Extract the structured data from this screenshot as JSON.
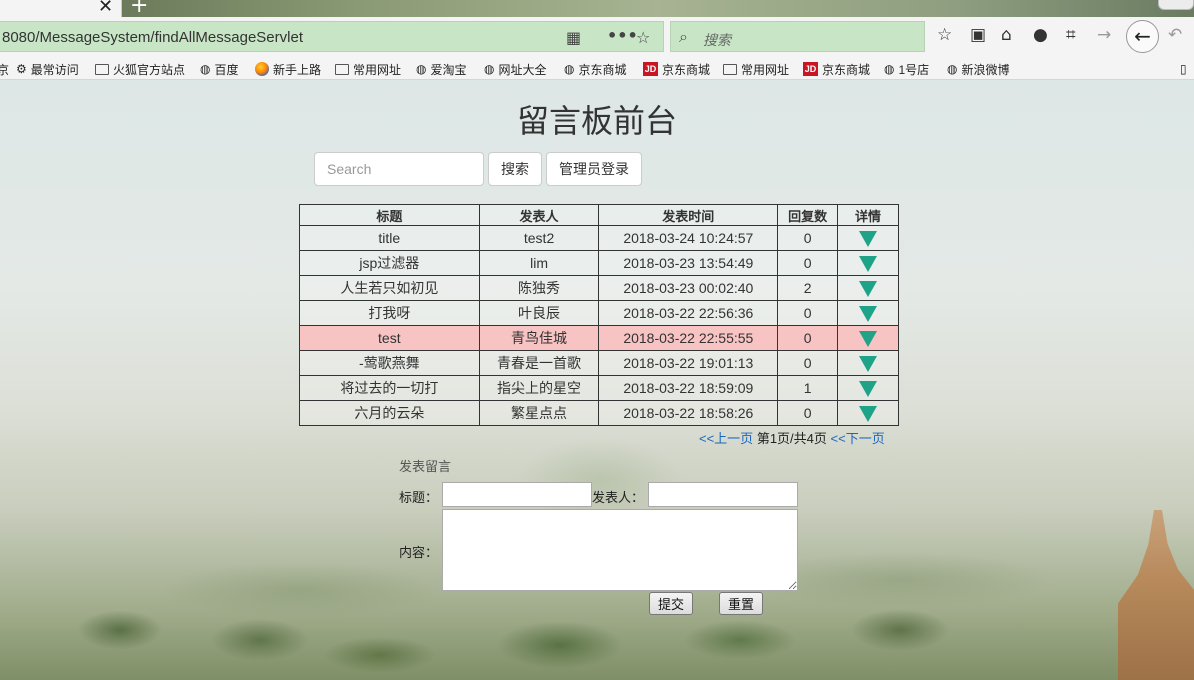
{
  "browser": {
    "url": "8080/MessageSystem/findAllMessageServlet",
    "search_placeholder": "搜索",
    "bookmarks": [
      "最常访问",
      "火狐官方站点",
      "百度",
      "新手上路",
      "常用网址",
      "爱淘宝",
      "网址大全",
      "京东商城",
      "京东商城",
      "常用网址",
      "京东商城",
      "1号店",
      "新浪微博"
    ],
    "bookmark_prefix": "京"
  },
  "page": {
    "title": "留言板前台",
    "search_placeholder": "Search",
    "search_button": "搜索",
    "admin_login_button": "管理员登录"
  },
  "table": {
    "columns": [
      "标题",
      "发表人",
      "发表时间",
      "回复数",
      "详情"
    ],
    "rows": [
      {
        "title": "title",
        "author": "test2",
        "time": "2018-03-24 10:24:57",
        "replies": "0"
      },
      {
        "title": "jsp过滤器",
        "author": "lim",
        "time": "2018-03-23 13:54:49",
        "replies": "0"
      },
      {
        "title": "人生若只如初见",
        "author": "陈独秀",
        "time": "2018-03-23 00:02:40",
        "replies": "2"
      },
      {
        "title": "打我呀",
        "author": "叶良辰",
        "time": "2018-03-22 22:56:36",
        "replies": "0"
      },
      {
        "title": "test",
        "author": "青鸟佳城",
        "time": "2018-03-22 22:55:55",
        "replies": "0"
      },
      {
        "title": "-莺歌燕舞",
        "author": "青春是一首歌",
        "time": "2018-03-22 19:01:13",
        "replies": "0"
      },
      {
        "title": "将过去的一切打",
        "author": "指尖上的星空",
        "time": "2018-03-22 18:59:09",
        "replies": "1"
      },
      {
        "title": "六月的云朵",
        "author": "繁星点点",
        "time": "2018-03-22 18:58:26",
        "replies": "0"
      }
    ],
    "highlight_row_color": "#f7c3c3",
    "detail_icon_color": "#1fa388"
  },
  "pager": {
    "prev": "<<上一页",
    "status": "第1页/共4页",
    "next": "<<下一页"
  },
  "form": {
    "legend": "发表留言",
    "title_label": "标题：",
    "author_label": "发表人：",
    "content_label": "内容：",
    "submit": "提交",
    "reset": "重置"
  }
}
